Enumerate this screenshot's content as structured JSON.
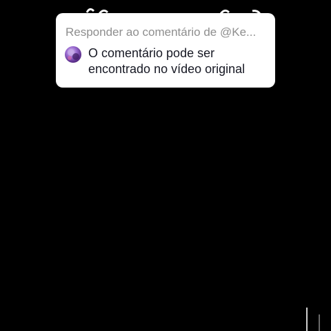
{
  "reply_card": {
    "header": "Responder ao comentário de @Ke...",
    "comment_line_1": "O comentário pode ser",
    "comment_line_2": "encontrado no vídeo original"
  },
  "colors": {
    "background": "#000000",
    "card": "#ffffff",
    "header_text": "#8e8e8e",
    "comment_text": "#161823"
  }
}
